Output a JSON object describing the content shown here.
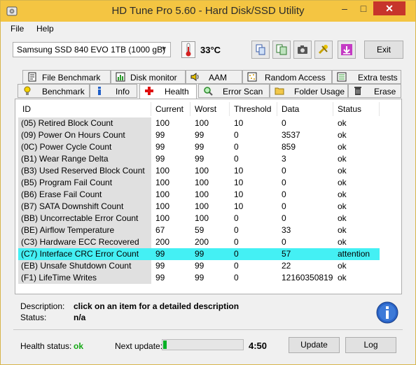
{
  "window": {
    "title": "HD Tune Pro 5.60 - Hard Disk/SSD Utility"
  },
  "menu": [
    "File",
    "Help"
  ],
  "toolbar": {
    "drive": "Samsung SSD 840 EVO 1TB (1000 gB)",
    "temperature": "33°C",
    "exit_label": "Exit",
    "icons": [
      "copy-icon",
      "save-icon",
      "camera-icon",
      "tools-icon",
      "download-icon"
    ]
  },
  "tabs_top": [
    {
      "label": "File Benchmark",
      "icon": "file-benchmark-icon"
    },
    {
      "label": "Disk monitor",
      "icon": "disk-monitor-icon"
    },
    {
      "label": "AAM",
      "icon": "speaker-icon"
    },
    {
      "label": "Random Access",
      "icon": "random-access-icon"
    },
    {
      "label": "Extra tests",
      "icon": "extra-tests-icon"
    }
  ],
  "tabs_bottom": [
    {
      "label": "Benchmark",
      "icon": "benchmark-icon"
    },
    {
      "label": "Info",
      "icon": "info-icon"
    },
    {
      "label": "Health",
      "icon": "health-cross-icon",
      "active": true
    },
    {
      "label": "Error Scan",
      "icon": "magnifier-icon"
    },
    {
      "label": "Folder Usage",
      "icon": "folder-icon"
    },
    {
      "label": "Erase",
      "icon": "trash-icon"
    }
  ],
  "table": {
    "headers": [
      "ID",
      "Current",
      "Worst",
      "Threshold",
      "Data",
      "Status"
    ],
    "rows": [
      [
        "(05) Retired Block Count",
        "100",
        "100",
        "10",
        "0",
        "ok"
      ],
      [
        "(09) Power On Hours Count",
        "99",
        "99",
        "0",
        "3537",
        "ok"
      ],
      [
        "(0C) Power Cycle Count",
        "99",
        "99",
        "0",
        "859",
        "ok"
      ],
      [
        "(B1) Wear Range Delta",
        "99",
        "99",
        "0",
        "3",
        "ok"
      ],
      [
        "(B3) Used Reserved Block Count",
        "100",
        "100",
        "10",
        "0",
        "ok"
      ],
      [
        "(B5) Program Fail Count",
        "100",
        "100",
        "10",
        "0",
        "ok"
      ],
      [
        "(B6) Erase Fail Count",
        "100",
        "100",
        "10",
        "0",
        "ok"
      ],
      [
        "(B7) SATA Downshift Count",
        "100",
        "100",
        "10",
        "0",
        "ok"
      ],
      [
        "(BB) Uncorrectable Error Count",
        "100",
        "100",
        "0",
        "0",
        "ok"
      ],
      [
        "(BE) Airflow Temperature",
        "67",
        "59",
        "0",
        "33",
        "ok"
      ],
      [
        "(C3) Hardware ECC Recovered",
        "200",
        "200",
        "0",
        "0",
        "ok"
      ],
      [
        "(C7) Interface CRC Error Count",
        "99",
        "99",
        "0",
        "57",
        "attention"
      ],
      [
        "(EB) Unsafe Shutdown Count",
        "99",
        "99",
        "0",
        "22",
        "ok"
      ],
      [
        "(F1) LifeTime Writes",
        "99",
        "99",
        "0",
        "12160350819",
        "ok"
      ]
    ],
    "highlight_color": "#44f0f4"
  },
  "description": {
    "desc_label": "Description:",
    "desc_value": "click on an item for a detailed description",
    "status_label": "Status:",
    "status_value": "n/a"
  },
  "footer": {
    "health_label": "Health status:",
    "health_value": "ok",
    "next_label": "Next update:",
    "progress": 0.04,
    "timer": "4:50",
    "update_label": "Update",
    "log_label": "Log"
  }
}
